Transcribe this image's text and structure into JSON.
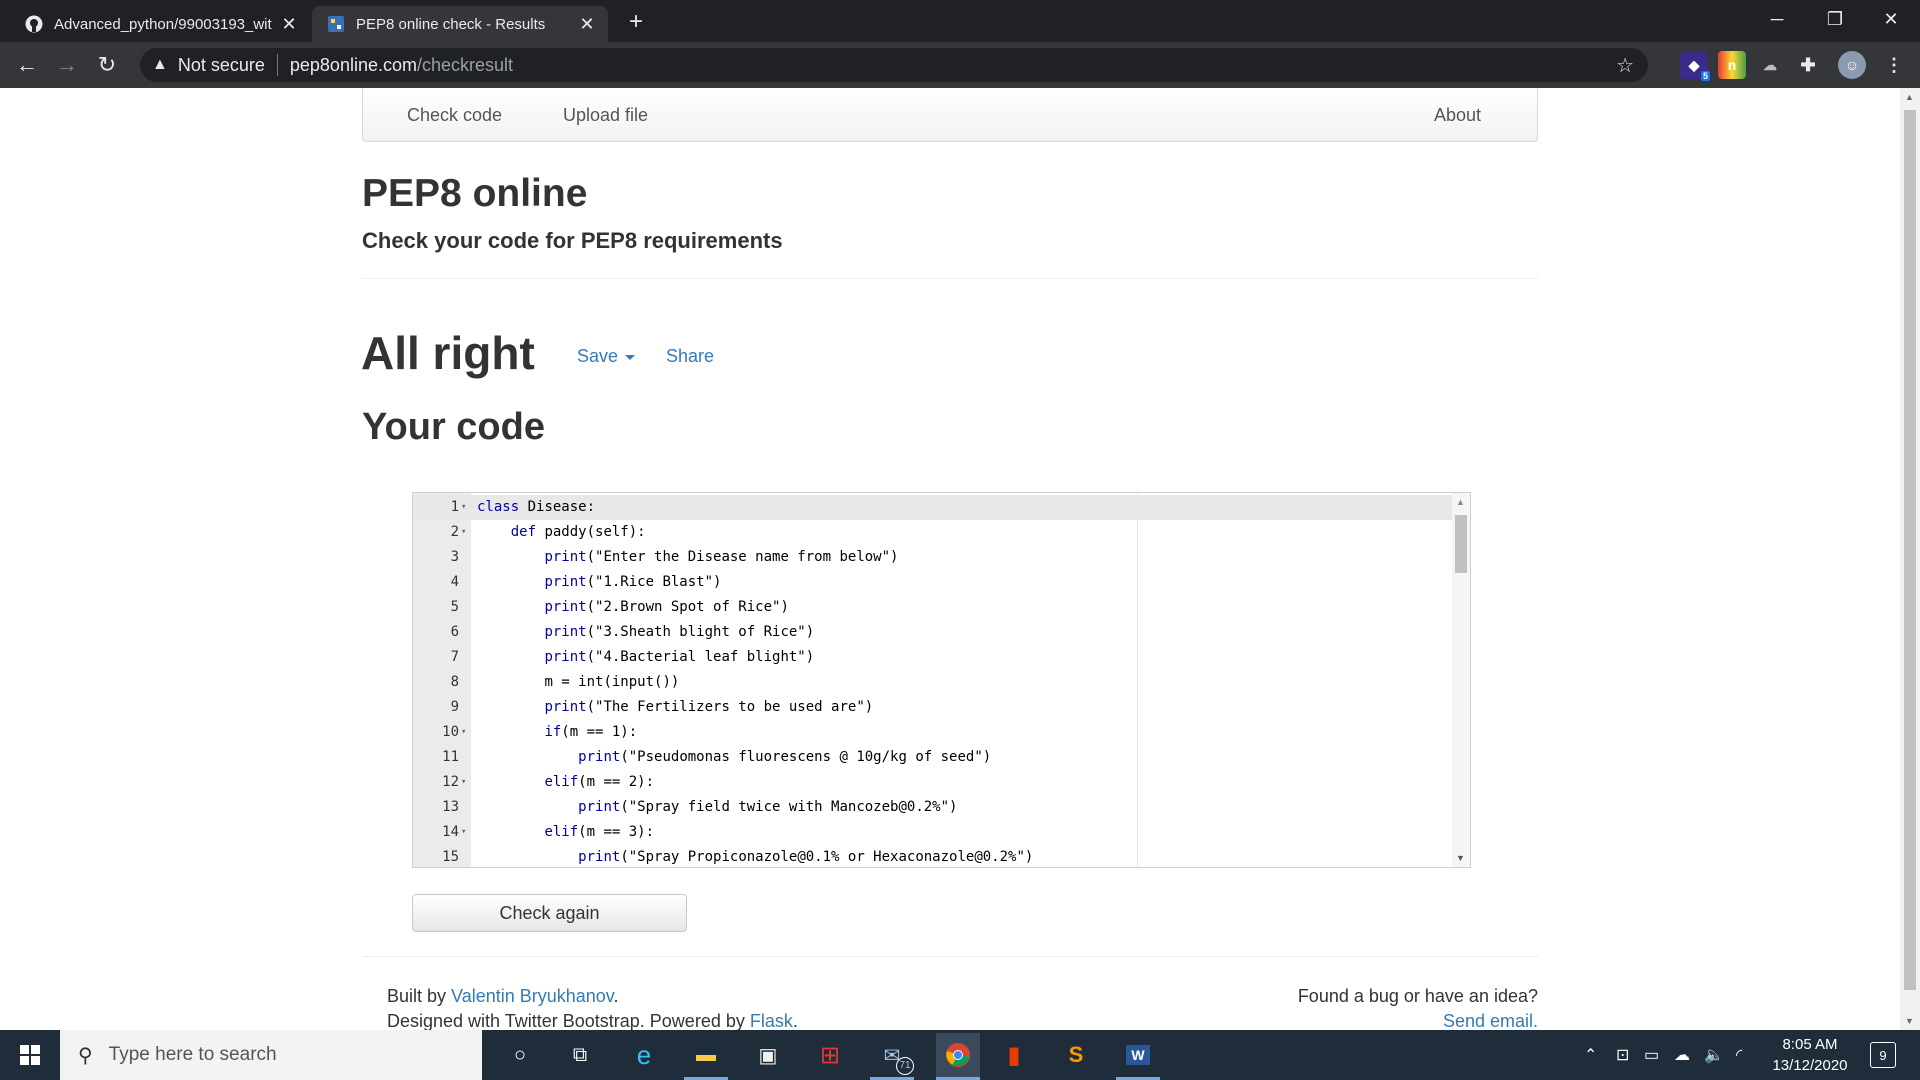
{
  "browser": {
    "tabs": [
      {
        "title": "Advanced_python/99003193_wit",
        "active": false,
        "icon": "github-icon"
      },
      {
        "title": "PEP8 online check - Results",
        "active": true,
        "icon": "pep8-favicon-icon"
      }
    ],
    "security_label": "Not secure",
    "url_host": "pep8online.com",
    "url_path": "/checkresult",
    "extension_badge": "5"
  },
  "site": {
    "nav": {
      "check_code": "Check code",
      "upload_file": "Upload file",
      "about": "About"
    },
    "title": "PEP8 online",
    "subtitle": "Check your code for PEP8 requirements",
    "result_heading": "All right",
    "save_label": "Save",
    "share_label": "Share",
    "code_heading": "Your code",
    "check_again_label": "Check again",
    "footer": {
      "built_by_prefix": "Built by ",
      "author": "Valentin Bryukhanov",
      "built_by_suffix": ".",
      "designed_prefix": "Designed with Twitter Bootstrap. Powered by ",
      "flask": "Flask",
      "designed_suffix": ".",
      "bug_text": "Found a bug or have an idea?",
      "send_email": "Send email."
    }
  },
  "code_lines": [
    {
      "n": "1",
      "fold": true,
      "indent": "",
      "kw": "class",
      "rest": " Disease:"
    },
    {
      "n": "2",
      "fold": true,
      "indent": "    ",
      "kw": "def",
      "rest": " paddy(self):"
    },
    {
      "n": "3",
      "fold": false,
      "indent": "        ",
      "kw": "print",
      "rest": "(\"Enter the Disease name from below\")"
    },
    {
      "n": "4",
      "fold": false,
      "indent": "        ",
      "kw": "print",
      "rest": "(\"1.Rice Blast\")"
    },
    {
      "n": "5",
      "fold": false,
      "indent": "        ",
      "kw": "print",
      "rest": "(\"2.Brown Spot of Rice\")"
    },
    {
      "n": "6",
      "fold": false,
      "indent": "        ",
      "kw": "print",
      "rest": "(\"3.Sheath blight of Rice\")"
    },
    {
      "n": "7",
      "fold": false,
      "indent": "        ",
      "kw": "print",
      "rest": "(\"4.Bacterial leaf blight\")"
    },
    {
      "n": "8",
      "fold": false,
      "indent": "        ",
      "kw": "",
      "rest": "m = int(input())"
    },
    {
      "n": "9",
      "fold": false,
      "indent": "        ",
      "kw": "print",
      "rest": "(\"The Fertilizers to be used are\")"
    },
    {
      "n": "10",
      "fold": true,
      "indent": "        ",
      "kw": "if",
      "rest": "(m == 1):"
    },
    {
      "n": "11",
      "fold": false,
      "indent": "            ",
      "kw": "print",
      "rest": "(\"Pseudomonas fluorescens @ 10g/kg of seed\")"
    },
    {
      "n": "12",
      "fold": true,
      "indent": "        ",
      "kw": "elif",
      "rest": "(m == 2):"
    },
    {
      "n": "13",
      "fold": false,
      "indent": "            ",
      "kw": "print",
      "rest": "(\"Spray field twice with Mancozeb@0.2%\")"
    },
    {
      "n": "14",
      "fold": true,
      "indent": "        ",
      "kw": "elif",
      "rest": "(m == 3):"
    },
    {
      "n": "15",
      "fold": false,
      "indent": "            ",
      "kw": "print",
      "rest": "(\"Spray Propiconazole@0.1% or Hexaconazole@0.2%\")"
    }
  ],
  "taskbar": {
    "search_placeholder": "Type here to search",
    "mail_badge": "71",
    "time": "8:05 AM",
    "date": "13/12/2020",
    "notifications": "9"
  },
  "colors": {
    "link": "#337ab7",
    "chrome_dark": "#202124",
    "taskbar": "#1f2c3a"
  }
}
